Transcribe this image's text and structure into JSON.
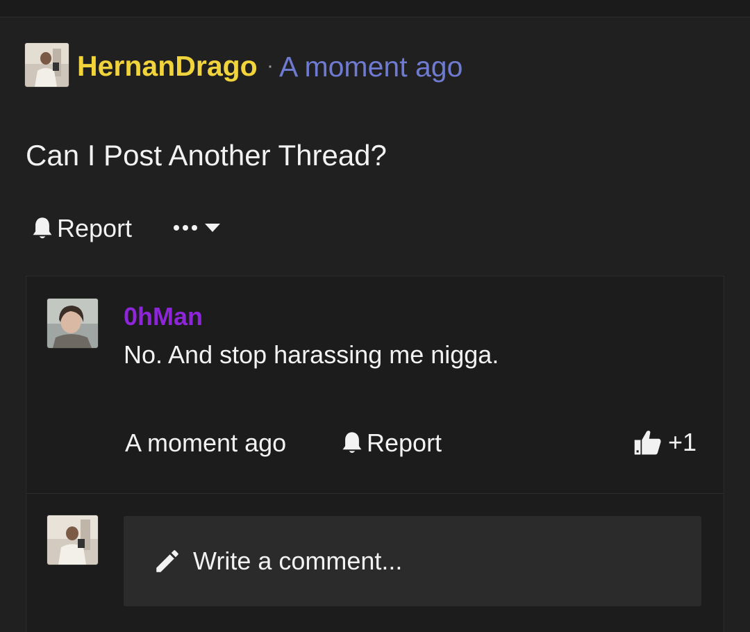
{
  "post": {
    "author": "HernanDrago",
    "separator": "·",
    "time": "A moment ago",
    "title": "Can I Post Another Thread?",
    "actions": {
      "report_label": "Report",
      "report_icon": "bell-icon",
      "more_icon": "ellipsis-icon",
      "dropdown_icon": "caret-down-icon"
    }
  },
  "comment": {
    "author": "0hMan",
    "text": "No. And stop harassing me nigga.",
    "time": "A moment ago",
    "report_label": "Report",
    "like_count": "+1",
    "like_icon": "thumbs-up-icon"
  },
  "reply_box": {
    "placeholder": "Write a comment...",
    "icon": "pencil-icon"
  },
  "colors": {
    "background": "#202020",
    "author_name": "#f1d33c",
    "timestamp": "#6f7bd0",
    "commenter_name": "#8d25d8",
    "text": "#f2f2f2",
    "comment_bg": "#1c1c1c",
    "input_bg": "#2b2b2b"
  }
}
